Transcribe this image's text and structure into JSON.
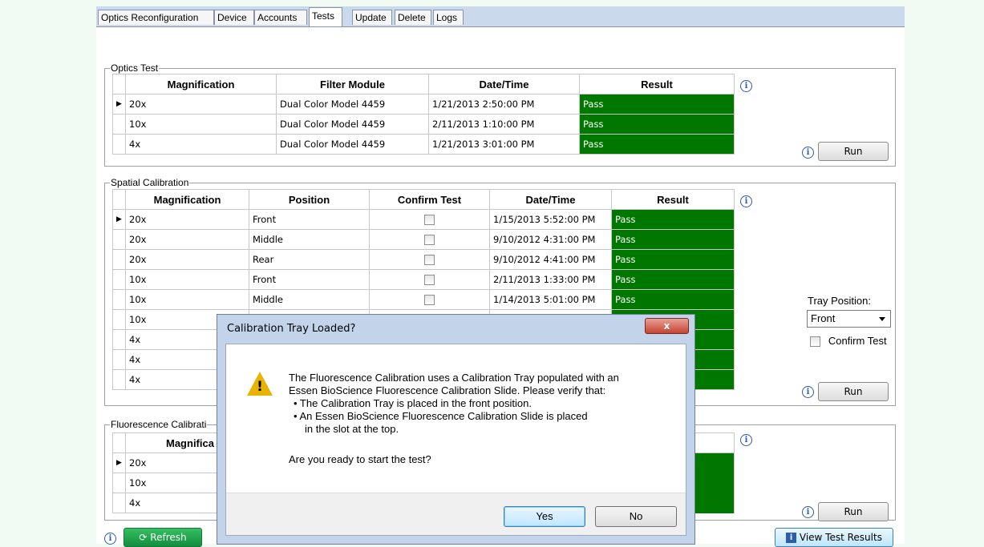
{
  "tabs": [
    {
      "label": "Optics Reconfiguration",
      "active": false
    },
    {
      "label": "Device",
      "active": false
    },
    {
      "label": "Accounts",
      "active": false
    },
    {
      "label": "Tests",
      "active": true
    },
    {
      "label": "Update",
      "active": false
    },
    {
      "label": "Delete",
      "active": false
    },
    {
      "label": "Logs",
      "active": false
    }
  ],
  "optics_test": {
    "title": "Optics Test",
    "columns": [
      "Magnification",
      "Filter Module",
      "Date/Time",
      "Result"
    ],
    "rows": [
      {
        "selected": true,
        "magnification": "20x",
        "filter": "Dual Color Model 4459",
        "datetime": "1/21/2013 2:50:00 PM",
        "result": "Pass"
      },
      {
        "selected": false,
        "magnification": "10x",
        "filter": "Dual Color Model 4459",
        "datetime": "2/11/2013 1:10:00 PM",
        "result": "Pass"
      },
      {
        "selected": false,
        "magnification": "4x",
        "filter": "Dual Color Model 4459",
        "datetime": "1/21/2013 3:01:00 PM",
        "result": "Pass"
      }
    ],
    "run_label": "Run"
  },
  "spatial": {
    "title": "Spatial Calibration",
    "columns": [
      "Magnification",
      "Position",
      "Confirm Test",
      "Date/Time",
      "Result"
    ],
    "rows": [
      {
        "selected": true,
        "magnification": "20x",
        "position": "Front",
        "datetime": "1/15/2013 5:52:00 PM",
        "result": "Pass"
      },
      {
        "selected": false,
        "magnification": "20x",
        "position": "Middle",
        "datetime": "9/10/2012 4:31:00 PM",
        "result": "Pass"
      },
      {
        "selected": false,
        "magnification": "20x",
        "position": "Rear",
        "datetime": "9/10/2012 4:41:00 PM",
        "result": "Pass"
      },
      {
        "selected": false,
        "magnification": "10x",
        "position": "Front",
        "datetime": "2/11/2013 1:33:00 PM",
        "result": "Pass"
      },
      {
        "selected": false,
        "magnification": "10x",
        "position": "Middle",
        "datetime": "1/14/2013 5:01:00 PM",
        "result": "Pass"
      },
      {
        "selected": false,
        "magnification": "10x",
        "position": "",
        "datetime": "",
        "result": ""
      },
      {
        "selected": false,
        "magnification": "4x",
        "position": "",
        "datetime": "",
        "result": ""
      },
      {
        "selected": false,
        "magnification": "4x",
        "position": "",
        "datetime": "",
        "result": ""
      },
      {
        "selected": false,
        "magnification": "4x",
        "position": "",
        "datetime": "",
        "result": ""
      }
    ],
    "tray_position_label": "Tray Position:",
    "tray_position_value": "Front",
    "confirm_test_label": "Confirm Test",
    "run_label": "Run"
  },
  "fluorescence": {
    "title": "Fluorescence Calibrati",
    "columns": [
      "Magnifica"
    ],
    "rows": [
      {
        "selected": true,
        "magnification": "20x"
      },
      {
        "selected": false,
        "magnification": "10x"
      },
      {
        "selected": false,
        "magnification": "4x"
      }
    ],
    "run_label": "Run"
  },
  "footer": {
    "refresh_label": "Refresh",
    "view_results_label": "View Test Results"
  },
  "dialog": {
    "title": "Calibration Tray Loaded?",
    "close_glyph": "x",
    "lines": [
      "The Fluorescence Calibration uses a Calibration Tray populated with an",
      "Essen BioScience Fluorescence Calibration Slide.  Please verify that:",
      "• The Calibration Tray is placed in the front position.",
      "• An Essen BioScience Fluorescence Calibration Slide is placed",
      "in the slot at the top."
    ],
    "question": "Are you ready to start the test?",
    "yes_label": "Yes",
    "no_label": "No"
  },
  "colors": {
    "pass_green": "#007800",
    "tabstrip": "#cbd9ec",
    "dialog_frame": "#c3d4ea",
    "refresh_green": "#1ea34a"
  }
}
